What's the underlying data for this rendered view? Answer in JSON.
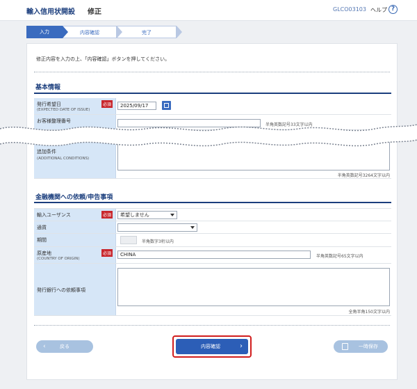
{
  "header": {
    "title": "輸入信用状開設",
    "subtitle": "修正",
    "screen_code": "GLCO03103",
    "help_label": "ヘルプ",
    "help_icon": "?"
  },
  "steps": [
    {
      "label": "入力",
      "active": true
    },
    {
      "label": "内容確認",
      "active": false
    },
    {
      "label": "完了",
      "active": false
    }
  ],
  "intro": "修正内容を入力の上、「内容確認」ボタンを押してください。",
  "basic": {
    "title": "基本情報",
    "issue_date_label": "発行希望日",
    "issue_date_sub": "(EXPECTED DATE OF ISSUE)",
    "required": "必須",
    "issue_date_value": "2025/09/17",
    "ref_label": "お客様整理番号",
    "ref_hint": "半角英数記号33文字以内",
    "add_cond_label": "追加条件",
    "add_cond_sub": "(ADDITIONAL CONDITIONS)",
    "add_cond_hint": "半角英数記号3264文字以内"
  },
  "finance": {
    "title": "金融機関への依頼/申告事項",
    "usance_label": "輸入ユーザンス",
    "required": "必須",
    "usance_value": "希望しません",
    "currency_label": "通貨",
    "currency_value": "",
    "period_label": "期間",
    "period_hint": "半角数字3桁以内",
    "origin_label": "原産地",
    "origin_sub": "(COUNTRY OF ORIGIN)",
    "origin_value": "CHINA",
    "origin_hint": "半角英数記号65文字以内",
    "request_label": "発行銀行への依頼事項",
    "request_hint": "全角半角150文字以内"
  },
  "buttons": {
    "back": "戻る",
    "confirm": "内容確認",
    "save": "一時保存"
  },
  "colors": {
    "primary": "#2c5eb7",
    "label_bg": "#d6e6f7",
    "required": "#c8262c",
    "highlight": "#d11d1d"
  }
}
